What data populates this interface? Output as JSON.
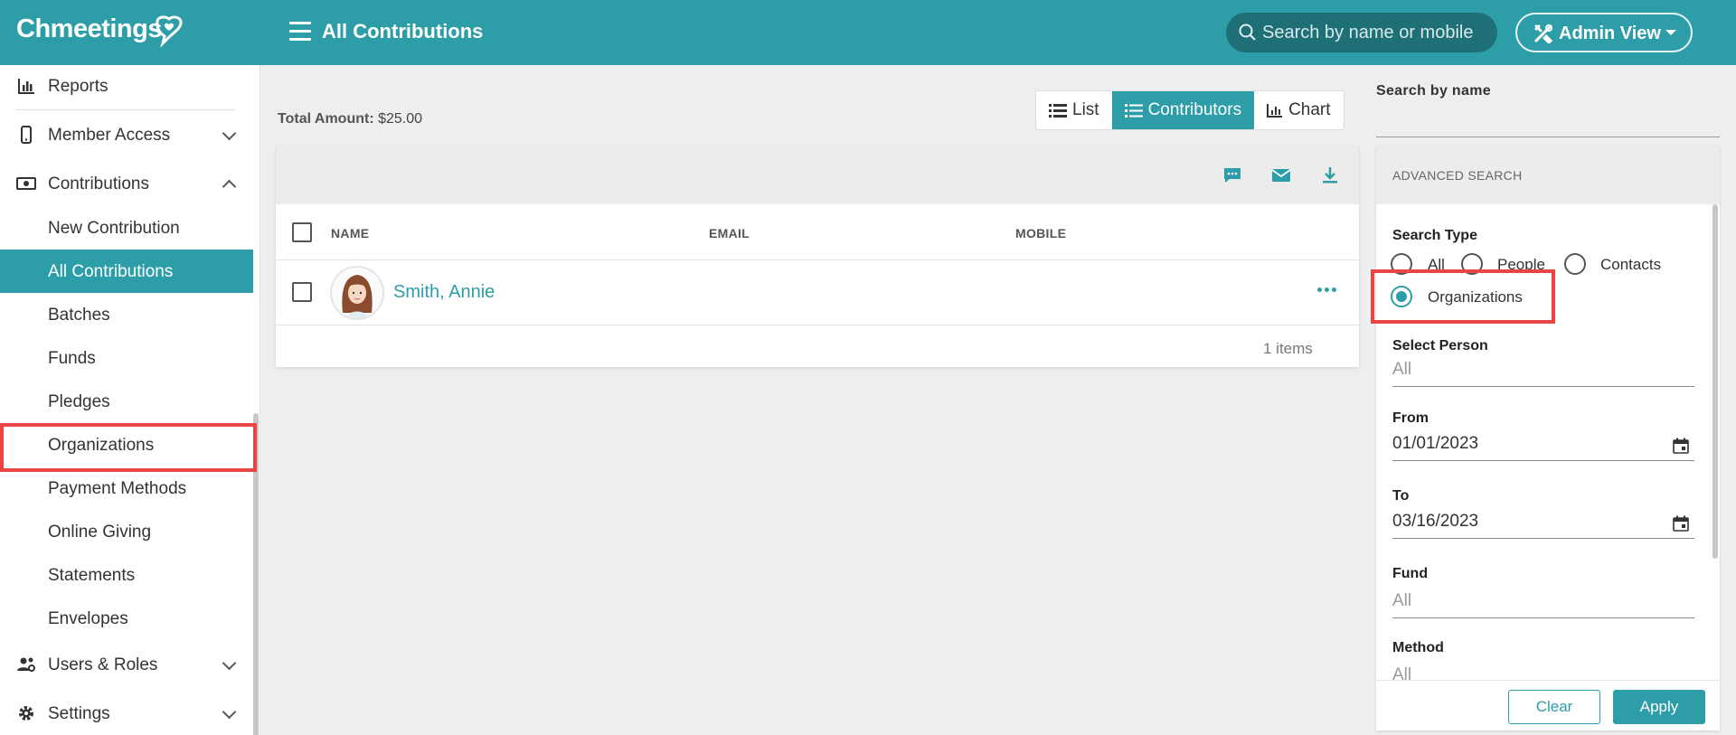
{
  "app": {
    "logo_text": "Chmeetings",
    "page_title": "All Contributions",
    "search_placeholder": "Search by name or mobile",
    "admin_button_label": "Admin View"
  },
  "sidebar": {
    "reports": "Reports",
    "member_access": "Member Access",
    "contributions": "Contributions",
    "sub_items": [
      "New Contribution",
      "All Contributions",
      "Batches",
      "Funds",
      "Pledges",
      "Organizations",
      "Payment Methods",
      "Online Giving",
      "Statements",
      "Envelopes"
    ],
    "active_sub_item": "All Contributions",
    "users_roles": "Users & Roles",
    "settings": "Settings"
  },
  "main": {
    "total_label": "Total Amount:",
    "total_value": "$25.00",
    "views": [
      "List",
      "Contributors",
      "Chart"
    ],
    "active_view": "Contributors",
    "columns": [
      "NAME",
      "EMAIL",
      "MOBILE"
    ],
    "rows": [
      {
        "name": "Smith, Annie",
        "email": "",
        "mobile": ""
      }
    ],
    "items_count": "1 items"
  },
  "right_panel": {
    "search_label": "Search by name",
    "advanced_title": "ADVANCED SEARCH",
    "search_type_label": "Search Type",
    "search_types": [
      "All",
      "People",
      "Contacts",
      "Organizations"
    ],
    "selected_search_type": "Organizations",
    "select_person_label": "Select Person",
    "select_person_value": "All",
    "from_label": "From",
    "from_value": "01/01/2023",
    "to_label": "To",
    "to_value": "03/16/2023",
    "fund_label": "Fund",
    "fund_value": "All",
    "method_label": "Method",
    "method_value": "All",
    "clear_label": "Clear",
    "apply_label": "Apply"
  },
  "colors": {
    "brand": "#2d9ea8",
    "highlight": "#e94545"
  }
}
